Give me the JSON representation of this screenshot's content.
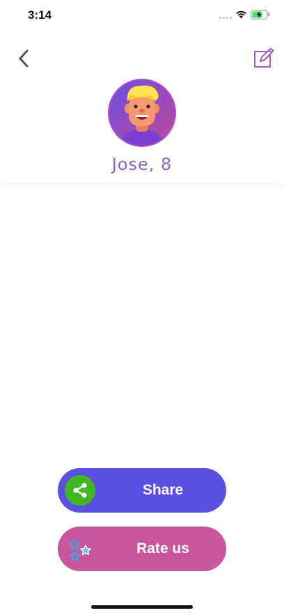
{
  "status_bar": {
    "time": "3:14",
    "wifi_icon": "wifi-icon",
    "battery_icon": "battery-charging-icon",
    "battery_color": "#4cd964"
  },
  "header": {
    "back_icon": "chevron-left-icon",
    "edit_icon": "edit-icon",
    "avatar_icon": "boy-avatar-icon",
    "profile_name": "Jose, 8",
    "accent_color": "#8a63c9"
  },
  "actions": {
    "share": {
      "label": "Share",
      "icon": "share-icon",
      "background": "#5a4fe3",
      "icon_background": "#43b723"
    },
    "rate": {
      "label": "Rate us",
      "icon": "stars-icon",
      "background": "#c7579a"
    }
  }
}
